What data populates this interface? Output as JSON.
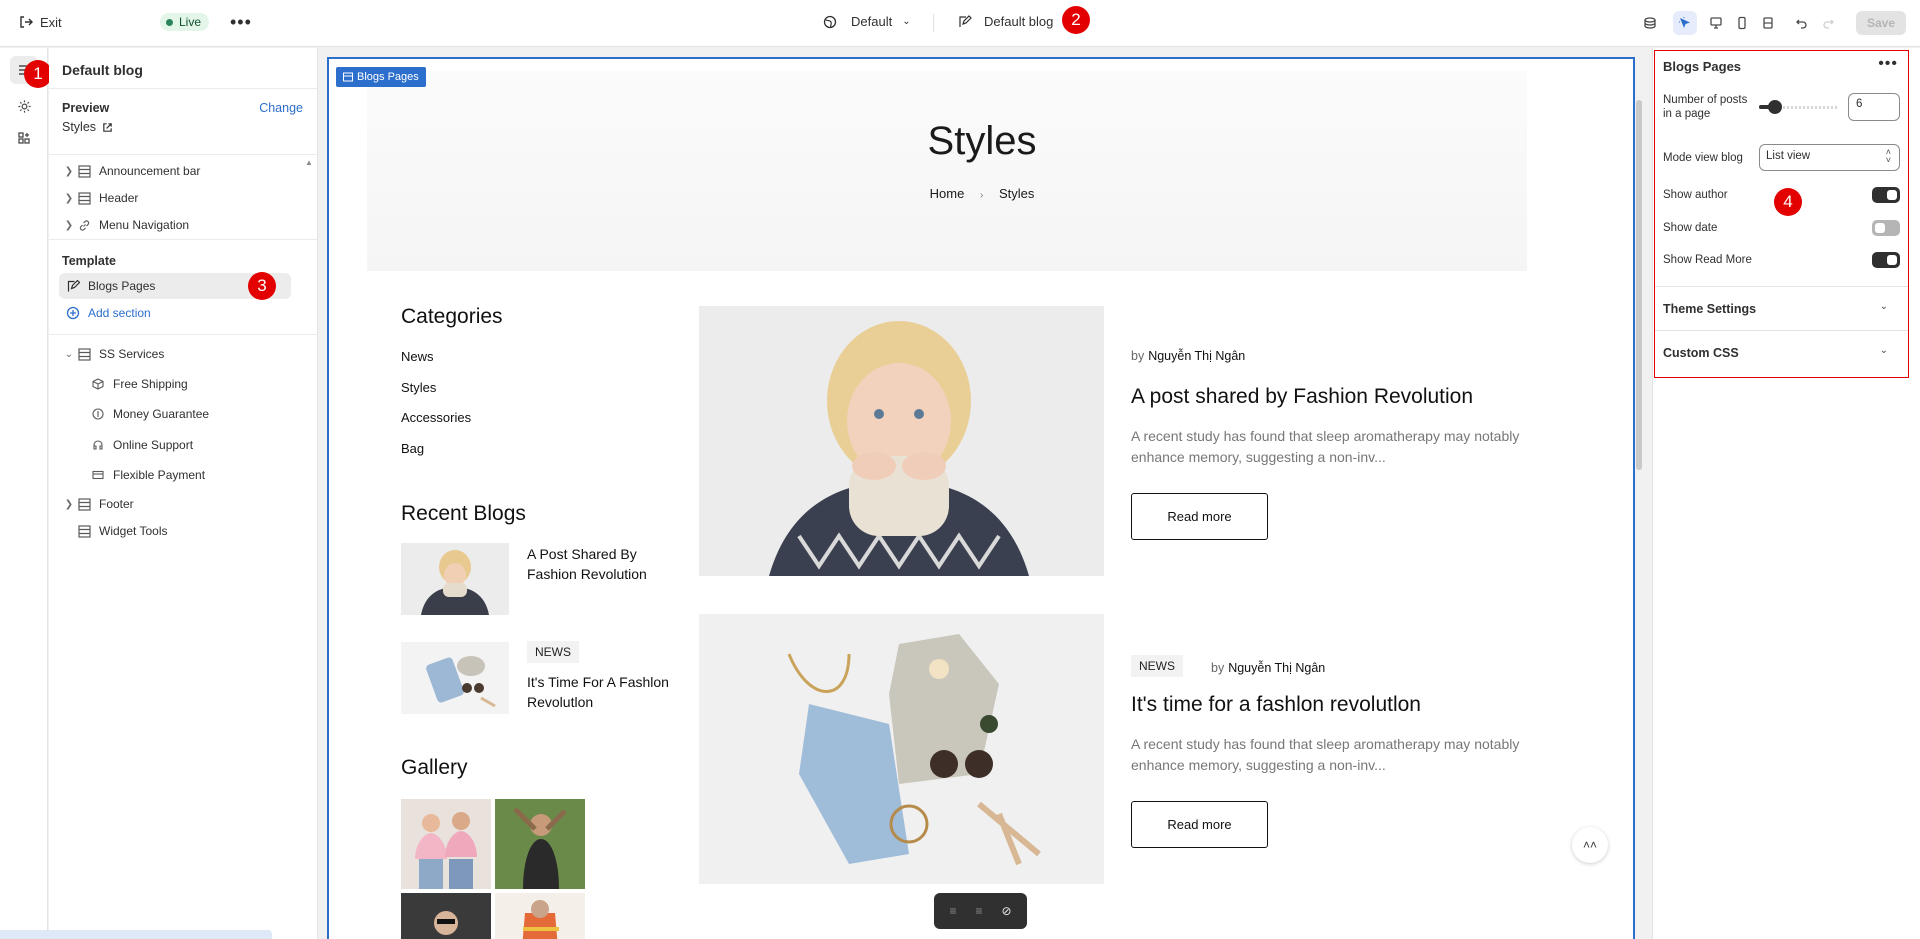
{
  "topbar": {
    "exit_label": "Exit",
    "live_label": "Live",
    "more_label": "•••",
    "theme_label": "Default",
    "template_label": "Default blog",
    "save_label": "Save"
  },
  "badges": {
    "b1": "1",
    "b2": "2",
    "b3": "3",
    "b4": "4"
  },
  "sidebar": {
    "title": "Default blog",
    "preview_label": "Preview",
    "change_label": "Change",
    "preview_value": "Styles",
    "header_items": [
      {
        "label": "Announcement bar",
        "icon": "layout-section-icon"
      },
      {
        "label": "Header",
        "icon": "layout-section-icon"
      },
      {
        "label": "Menu Navigation",
        "icon": "link-icon"
      }
    ],
    "template_label": "Template",
    "selected_item": "Blogs Pages",
    "add_section_label": "Add section",
    "group_label": "SS Services",
    "group_children": [
      {
        "label": "Free Shipping",
        "icon": "box-icon"
      },
      {
        "label": "Money Guarantee",
        "icon": "coin-icon"
      },
      {
        "label": "Online Support",
        "icon": "headset-icon"
      },
      {
        "label": "Flexible Payment",
        "icon": "card-icon"
      }
    ],
    "footer_items": [
      {
        "label": "Footer"
      },
      {
        "label": "Widget Tools"
      }
    ]
  },
  "canvas": {
    "frame_tag": "Blogs Pages",
    "hero_title": "Styles",
    "crumb_home": "Home",
    "crumb_sep": "›",
    "crumb_current": "Styles",
    "categories_heading": "Categories",
    "categories": [
      "News",
      "Styles",
      "Accessories",
      "Bag"
    ],
    "recent_heading": "Recent Blogs",
    "recent": [
      {
        "title": "A Post Shared By Fashion Revolution",
        "tag": ""
      },
      {
        "title": "It's Time For A Fashlon Revolutlon",
        "tag": "NEWS"
      }
    ],
    "gallery_heading": "Gallery",
    "posts": [
      {
        "tag": "",
        "by": "by",
        "author": "Nguyễn Thị Ngân",
        "title": "A post shared by Fashion Revolution",
        "excerpt": "A recent study has found that sleep aromatherapy may notably enhance memory, suggesting a non-inv...",
        "read_more": "Read more"
      },
      {
        "tag": "NEWS",
        "by": "by",
        "author": "Nguyễn Thị Ngân",
        "title": "It's time for a fashlon revolutlon",
        "excerpt": "A recent study has found that sleep aromatherapy may notably enhance memory, suggesting a non-inv...",
        "read_more": "Read more"
      }
    ]
  },
  "rpanel": {
    "title": "Blogs Pages",
    "posts_label": "Number of posts in a page",
    "posts_value": "6",
    "slider_fraction": 0.2,
    "mode_label": "Mode view blog",
    "mode_value": "List view",
    "show_author_label": "Show author",
    "show_author": true,
    "show_date_label": "Show date",
    "show_date": false,
    "show_read_more_label": "Show Read More",
    "show_read_more": true,
    "theme_settings_label": "Theme Settings",
    "custom_css_label": "Custom CSS"
  },
  "colors": {
    "accent": "#2c6ecb",
    "badge": "#e20000",
    "live": "#29845a"
  }
}
